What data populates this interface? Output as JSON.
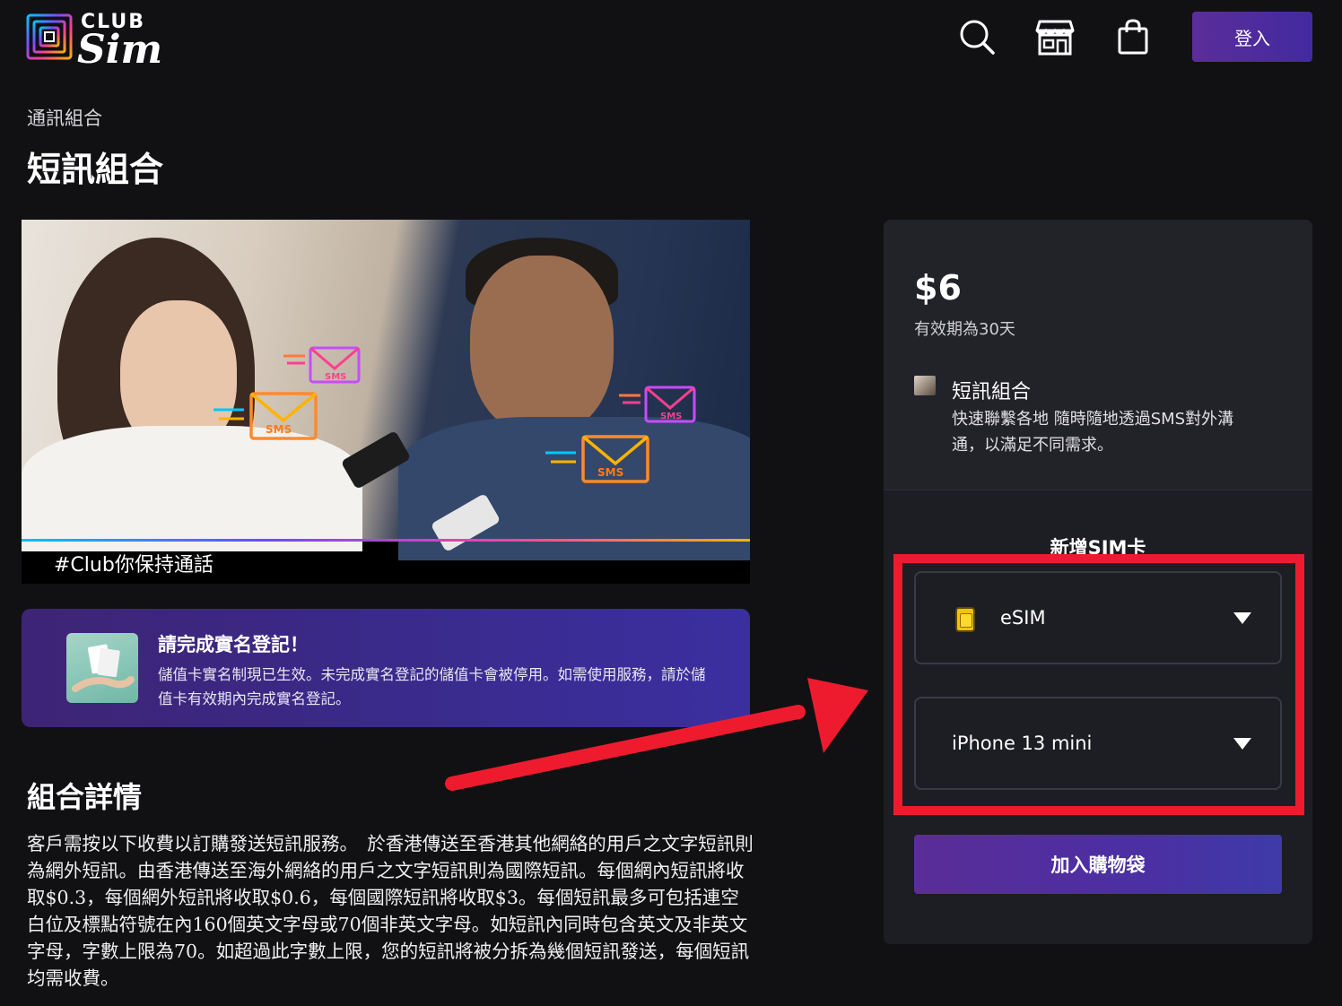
{
  "header": {
    "logo_top": "CLUB",
    "logo_bottom": "Sim",
    "icons": [
      "search-icon",
      "store-icon",
      "shopping-bag-icon"
    ],
    "login_label": "登入"
  },
  "breadcrumb": "通訊組合",
  "page_title": "短訊組合",
  "hero": {
    "caption": "#Club你保持通話",
    "envelope_label": "SMS"
  },
  "notice": {
    "title": "請完成實名登記！",
    "text": "儲值卡實名制現已生效。未完成實名登記的儲值卡會被停用。如需使用服務，請於儲值卡有效期內完成實名登記。"
  },
  "details": {
    "title": "組合詳情",
    "text": "客戶需按以下收費以訂購發送短訊服務。　於香港傳送至香港其他網絡的用戶之文字短訊則為網外短訊。由香港傳送至海外網絡的用戶之文字短訊則為國際短訊。每個網內短訊將收取$0.3，每個網外短訊將收取$0.6，每個國際短訊將收取$3。每個短訊最多可包括連空白位及標點符號在內160個英文字母或70個非英文字母。如短訊內同時包含英文及非英文字母，字數上限為70。如超過此字數上限，您的短訊將被分拆為幾個短訊發送，每個短訊均需收費。"
  },
  "panel": {
    "price": "$6",
    "validity": "有效期為30天",
    "plan_name": "短訊組合",
    "plan_desc": "快速聯繫各地 隨時隨地透過SMS對外溝通，以滿足不同需求。",
    "add_sim_title": "新增SIM卡",
    "sim_type": "eSIM",
    "device": "iPhone 13 mini",
    "add_cart_label": "加入購物袋"
  },
  "colors": {
    "background": "#111114",
    "accent_purple": "#5a2d98",
    "annotation_red": "#ee1b2e"
  }
}
